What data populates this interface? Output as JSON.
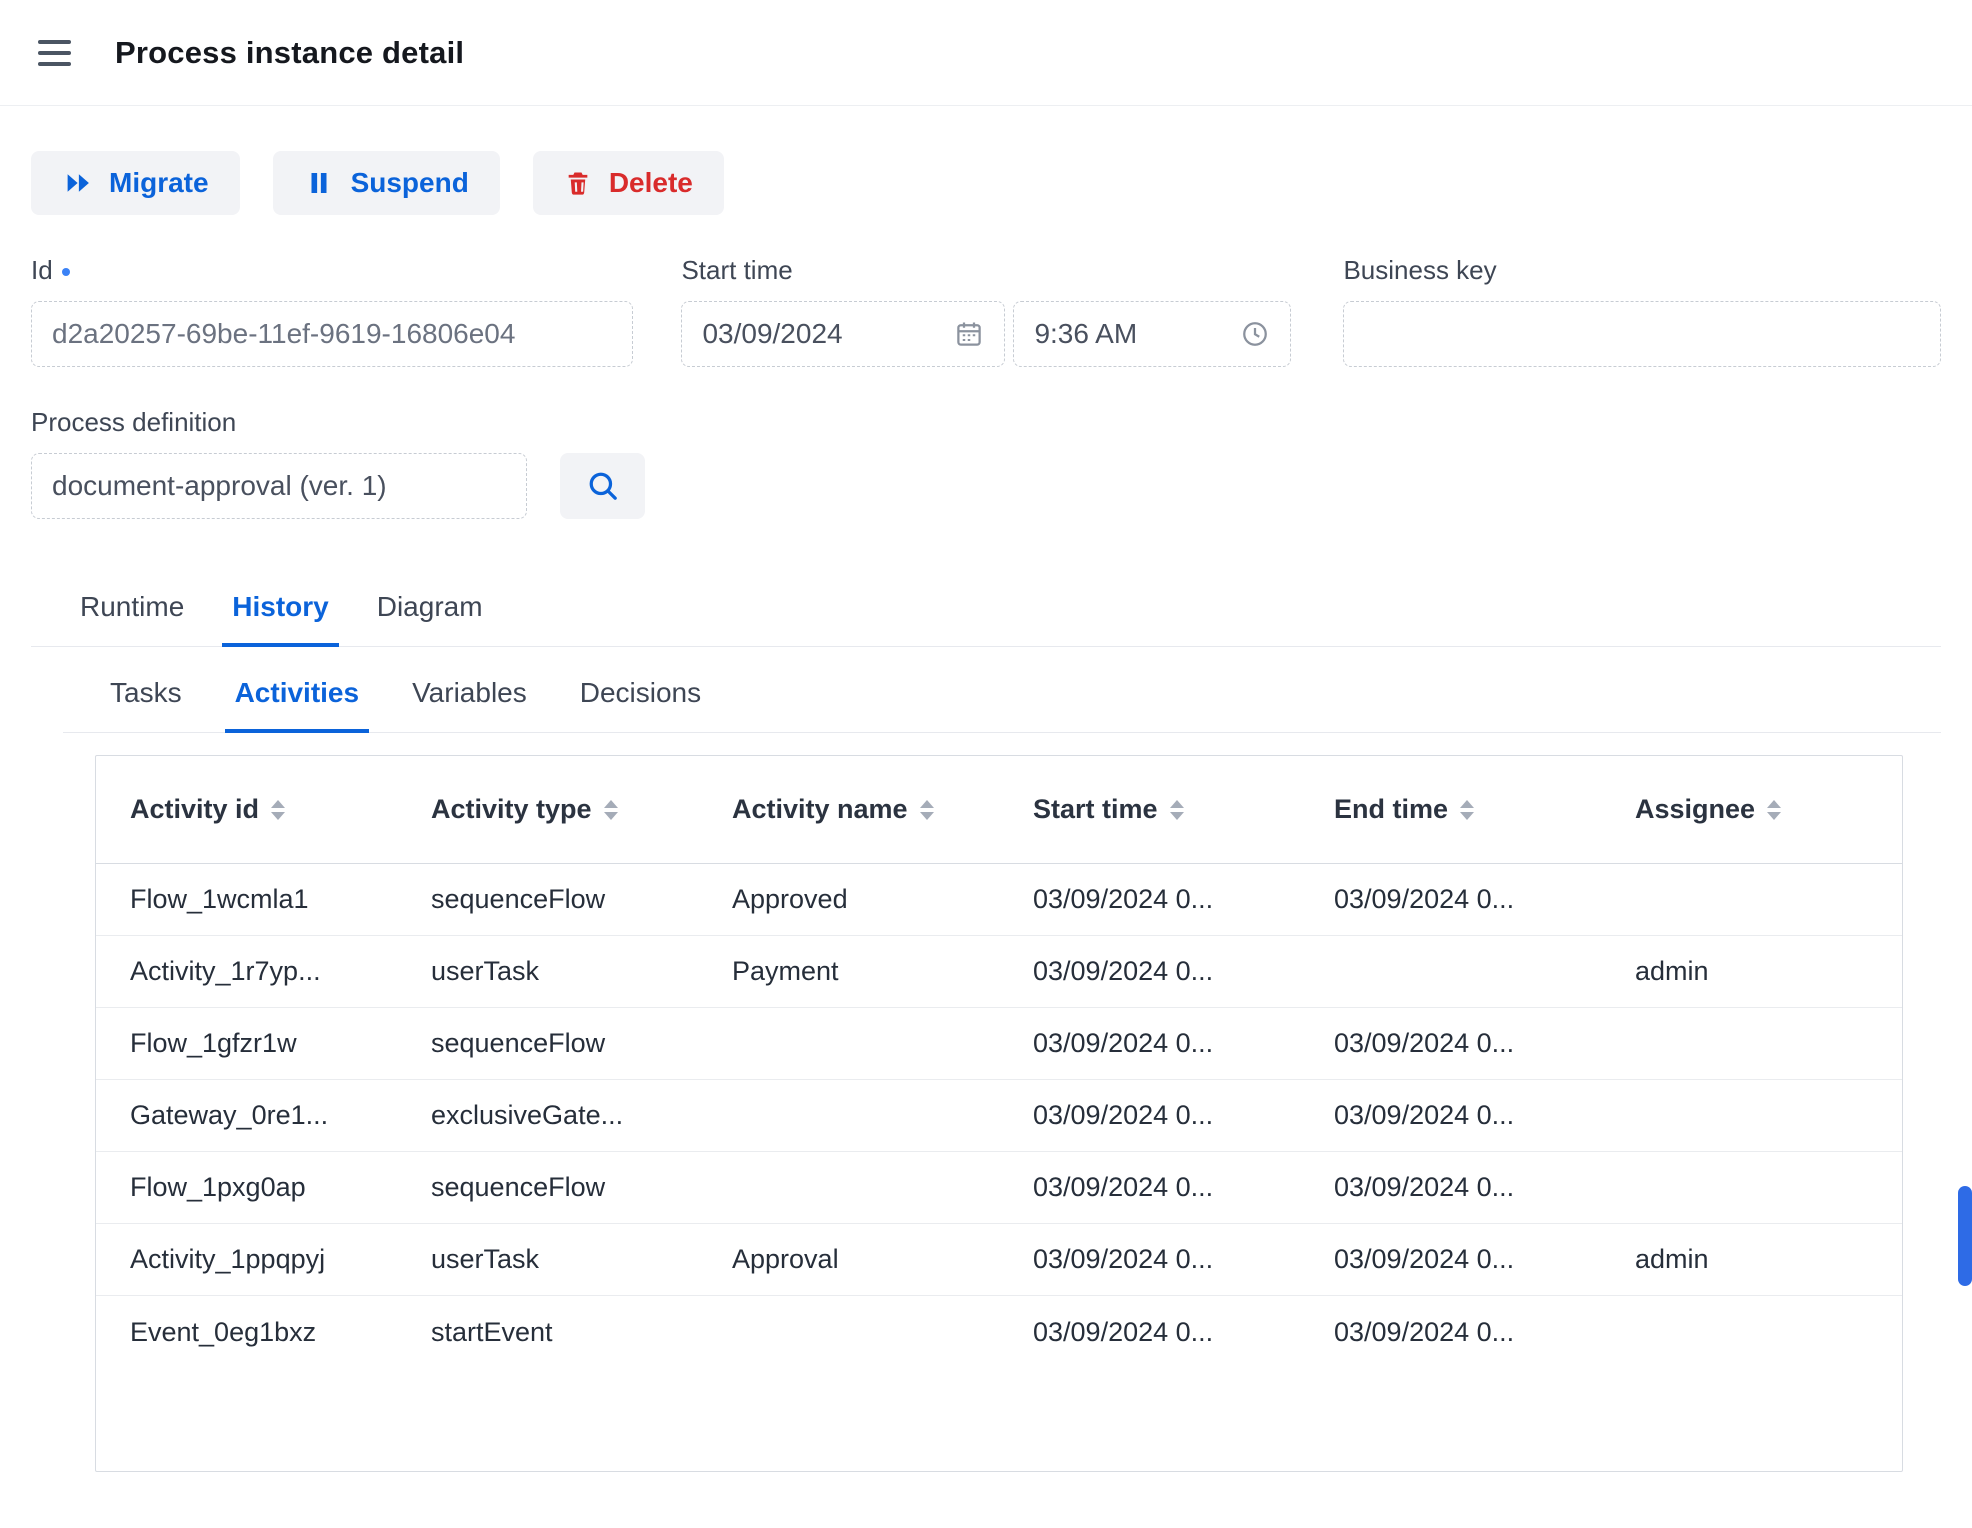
{
  "header": {
    "title": "Process instance detail"
  },
  "actions": {
    "migrate": "Migrate",
    "suspend": "Suspend",
    "delete": "Delete"
  },
  "form": {
    "id": {
      "label": "Id",
      "value": "d2a20257-69be-11ef-9619-16806e04"
    },
    "start_time": {
      "label": "Start time",
      "date": "03/09/2024",
      "time": "9:36 AM"
    },
    "business_key": {
      "label": "Business key",
      "value": ""
    },
    "process_definition": {
      "label": "Process definition",
      "value": "document-approval (ver. 1)"
    }
  },
  "tabs": [
    {
      "label": "Runtime",
      "active": false
    },
    {
      "label": "History",
      "active": true
    },
    {
      "label": "Diagram",
      "active": false
    }
  ],
  "subtabs": [
    {
      "label": "Tasks",
      "active": false
    },
    {
      "label": "Activities",
      "active": true
    },
    {
      "label": "Variables",
      "active": false
    },
    {
      "label": "Decisions",
      "active": false
    }
  ],
  "table": {
    "columns": [
      "Activity id",
      "Activity type",
      "Activity name",
      "Start time",
      "End time",
      "Assignee"
    ],
    "rows": [
      [
        "Flow_1wcmla1",
        "sequenceFlow",
        "Approved",
        "03/09/2024 0...",
        "03/09/2024 0...",
        ""
      ],
      [
        "Activity_1r7yp...",
        "userTask",
        "Payment",
        "03/09/2024 0...",
        "",
        "admin"
      ],
      [
        "Flow_1gfzr1w",
        "sequenceFlow",
        "",
        "03/09/2024 0...",
        "03/09/2024 0...",
        ""
      ],
      [
        "Gateway_0re1...",
        "exclusiveGate...",
        "",
        "03/09/2024 0...",
        "03/09/2024 0...",
        ""
      ],
      [
        "Flow_1pxg0ap",
        "sequenceFlow",
        "",
        "03/09/2024 0...",
        "03/09/2024 0...",
        ""
      ],
      [
        "Activity_1ppqpyj",
        "userTask",
        "Approval",
        "03/09/2024 0...",
        "03/09/2024 0...",
        "admin"
      ],
      [
        "Event_0eg1bxz",
        "startEvent",
        "",
        "03/09/2024 0...",
        "03/09/2024 0...",
        ""
      ]
    ]
  },
  "colors": {
    "accent": "#0b63da",
    "danger": "#d92b2b",
    "icon_gray": "#8b929e",
    "scrollbar": "#2e6be6"
  }
}
